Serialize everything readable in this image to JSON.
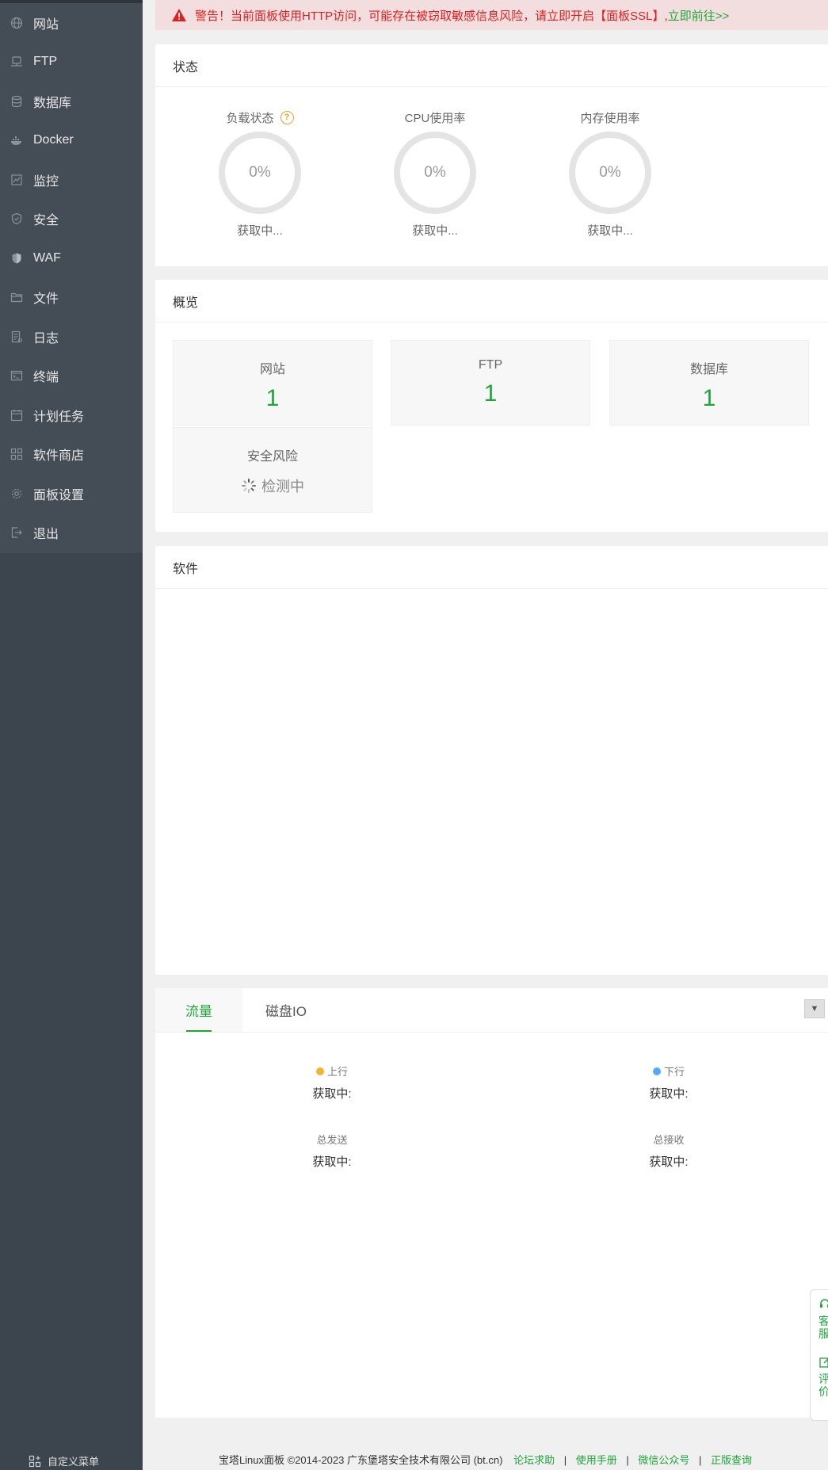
{
  "sidebar": {
    "items": [
      {
        "label": "网站",
        "icon": "globe-icon"
      },
      {
        "label": "FTP",
        "icon": "ftp-icon"
      },
      {
        "label": "数据库",
        "icon": "database-icon"
      },
      {
        "label": "Docker",
        "icon": "docker-icon"
      },
      {
        "label": "监控",
        "icon": "monitor-icon"
      },
      {
        "label": "安全",
        "icon": "shield-icon"
      },
      {
        "label": "WAF",
        "icon": "waf-shield-icon"
      },
      {
        "label": "文件",
        "icon": "folder-icon"
      },
      {
        "label": "日志",
        "icon": "log-icon"
      },
      {
        "label": "终端",
        "icon": "terminal-icon"
      },
      {
        "label": "计划任务",
        "icon": "calendar-icon"
      },
      {
        "label": "软件商店",
        "icon": "grid-icon"
      },
      {
        "label": "面板设置",
        "icon": "gear-icon"
      },
      {
        "label": "退出",
        "icon": "logout-icon"
      }
    ],
    "custom_menu_label": "自定义菜单"
  },
  "warning": {
    "text": "警告！当前面板使用HTTP访问，可能存在被窃取敏感信息风险，请立即开启【面板SSL】,",
    "link": "立即前往>>"
  },
  "status": {
    "title": "状态",
    "gauges": [
      {
        "title": "负载状态",
        "value": "0%",
        "sub": "获取中..."
      },
      {
        "title": "CPU使用率",
        "value": "0%",
        "sub": "获取中..."
      },
      {
        "title": "内存使用率",
        "value": "0%",
        "sub": "获取中..."
      }
    ],
    "help_label": "?"
  },
  "overview": {
    "title": "概览",
    "boxes": [
      {
        "label": "网站",
        "value": "1"
      },
      {
        "label": "FTP",
        "value": "1"
      },
      {
        "label": "数据库",
        "value": "1"
      }
    ],
    "security": {
      "label": "安全风险",
      "status": "检测中"
    }
  },
  "software": {
    "title": "软件"
  },
  "traffic": {
    "tabs": [
      "流量",
      "磁盘IO"
    ],
    "select_arrow": "▼",
    "up_label": "上行",
    "down_label": "下行",
    "up_value": "获取中:",
    "down_value": "获取中:",
    "sent_label": "总发送",
    "recv_label": "总接收",
    "sent_value": "获取中:",
    "recv_value": "获取中:",
    "up_color": "#f7b32b",
    "down_color": "#52a9ff"
  },
  "float_widget": {
    "service_text": "客服",
    "review_text": "评价"
  },
  "footer": {
    "copyright": "宝塔Linux面板 ©2014-2023 广东堡塔安全技术有限公司 (bt.cn)",
    "links": [
      "论坛求助",
      "使用手册",
      "微信公众号",
      "正版查询"
    ],
    "separator": "|"
  },
  "colors": {
    "accent": "#20a53a",
    "warning_text": "#e02020",
    "sidebar_bg": "#3c444d"
  }
}
